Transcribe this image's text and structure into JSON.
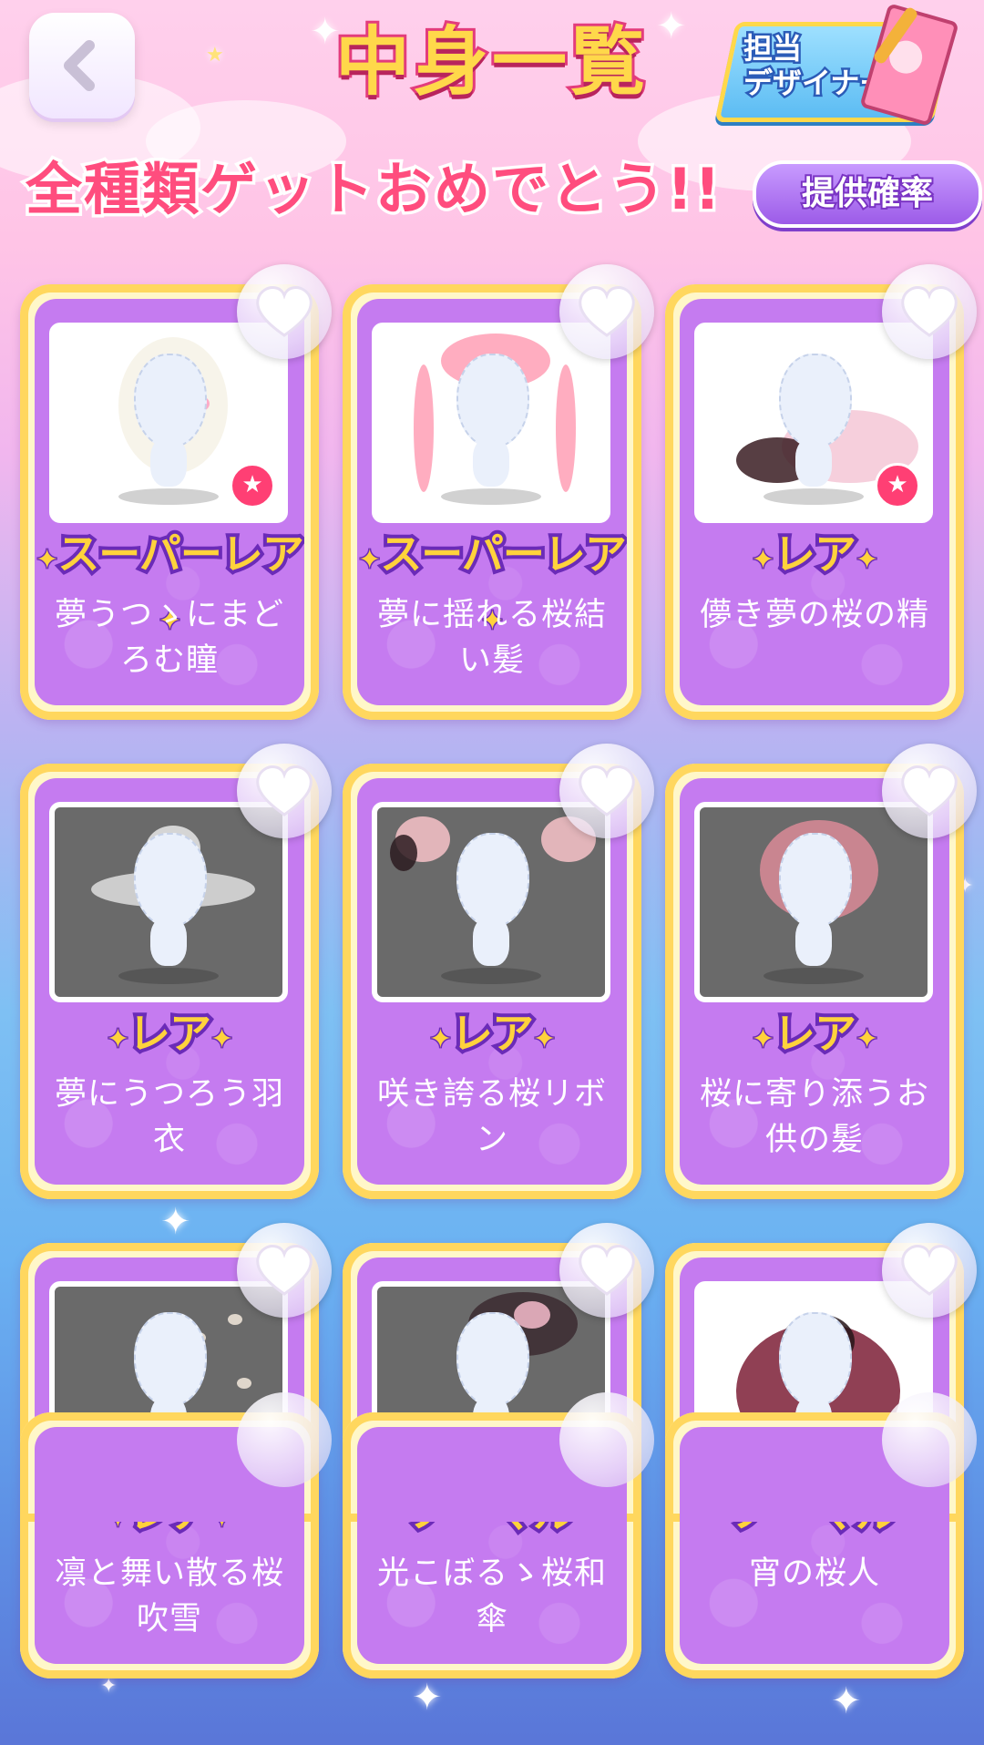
{
  "header": {
    "title": "中身一覧",
    "designer_label_line1": "担当",
    "designer_label_line2": "デザイナー",
    "congrats": "全種類ゲットおめでとう!!",
    "rate_button": "提供確率"
  },
  "colors": {
    "rarity_super": "#ffd23c",
    "card_bg": "#c57bf0",
    "card_frame": "#ffd75e",
    "accent_pink": "#ff4d7e"
  },
  "items": [
    {
      "rarity": "スーパーレア",
      "name_line1": "夢うつゝにまど",
      "name_line2": "ろむ瞳",
      "thumb": "light",
      "badge": true
    },
    {
      "rarity": "スーパーレア",
      "name_line1": "夢に揺れる桜結",
      "name_line2": "い髪",
      "thumb": "light",
      "badge": false
    },
    {
      "rarity": "レア",
      "name_line1": "儚き夢の桜の精",
      "name_line2": "",
      "thumb": "light",
      "badge": true
    },
    {
      "rarity": "レア",
      "name_line1": "夢にうつろう羽",
      "name_line2": "衣",
      "thumb": "dark",
      "badge": false
    },
    {
      "rarity": "レア",
      "name_line1": "咲き誇る桜リボ",
      "name_line2": "ン",
      "thumb": "dark",
      "badge": false
    },
    {
      "rarity": "レア",
      "name_line1": "桜に寄り添うお",
      "name_line2": "供の髪",
      "thumb": "dark",
      "badge": false
    },
    {
      "rarity": "レア",
      "name_line1": "凛と舞い散る桜",
      "name_line2": "吹雪",
      "thumb": "dark",
      "badge": false
    },
    {
      "rarity": "ノーマル",
      "name_line1": "光こぼるゝ桜和",
      "name_line2": "傘",
      "thumb": "dark",
      "badge": false
    },
    {
      "rarity": "ノーマル",
      "name_line1": "宵の桜人",
      "name_line2": "",
      "thumb": "light",
      "badge": false
    }
  ],
  "icons": {
    "back": "chevron-left-icon",
    "favorite": "heart-icon",
    "badge": "star-icon"
  }
}
